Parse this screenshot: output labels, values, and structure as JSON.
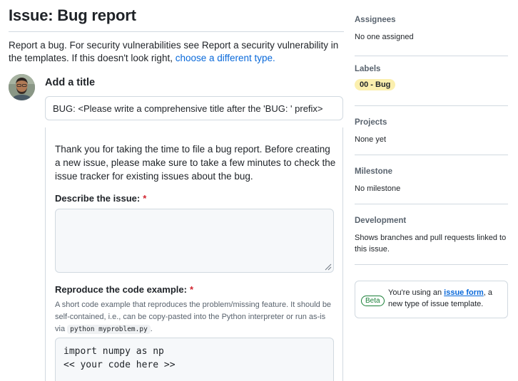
{
  "header": {
    "title": "Issue: Bug report"
  },
  "intro": {
    "text": "Report a bug. For security vulnerabilities see Report a security vulnerability in the templates. If this doesn't look right, ",
    "link": "choose a different type."
  },
  "title_field": {
    "label": "Add a title",
    "value": "BUG: <Please write a comprehensive title after the 'BUG: ' prefix>"
  },
  "form": {
    "intro": "Thank you for taking the time to file a bug report. Before creating a new issue, please make sure to take a few minutes to check the issue tracker for existing issues about the bug.",
    "describe_label": "Describe the issue:",
    "required_mark": "*",
    "reproduce_label": "Reproduce the code example:",
    "reproduce_desc": "A short code example that reproduces the problem/missing feature. It should be self-contained, i.e., can be copy-pasted into the Python interpreter or run as-is via ",
    "reproduce_desc_code": "python myproblem.py",
    "reproduce_desc_end": ".",
    "code_lines": [
      "import numpy as np",
      "<< your code here >>"
    ]
  },
  "sidebar": {
    "assignees": {
      "heading": "Assignees",
      "value": "No one assigned"
    },
    "labels": {
      "heading": "Labels",
      "label": "00 - Bug",
      "label_color": "#fbefae"
    },
    "projects": {
      "heading": "Projects",
      "value": "None yet"
    },
    "milestone": {
      "heading": "Milestone",
      "value": "No milestone"
    },
    "development": {
      "heading": "Development",
      "value": "Shows branches and pull requests linked to this issue."
    }
  },
  "beta_notice": {
    "badge": "Beta",
    "text_before": "You're using an ",
    "link": "issue form",
    "text_after": ", a new type of issue template."
  },
  "colors": {
    "link": "#0969da",
    "required": "#d1242f",
    "beta": "#1a7f37",
    "border": "#d1d9e0"
  }
}
